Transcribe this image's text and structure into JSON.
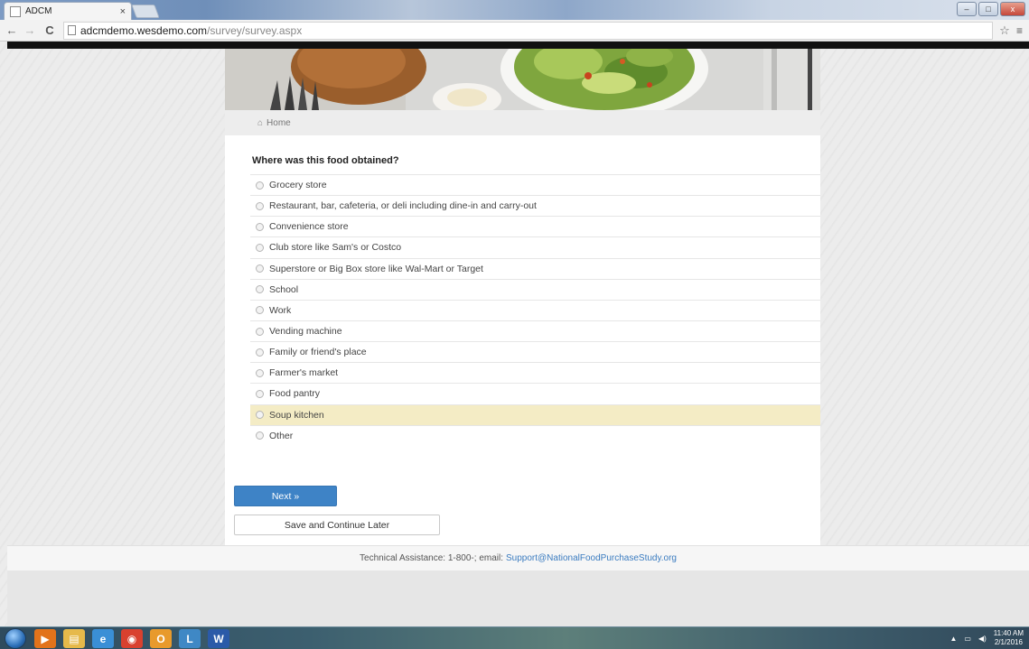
{
  "browser": {
    "tab_title": "ADCM",
    "tab_close": "×",
    "url_host": "adcmdemo.wesdemo.com",
    "url_path": "/survey/survey.aspx",
    "back": "←",
    "forward": "→",
    "reload": "C",
    "star": "☆",
    "menu": "≡",
    "win_min": "–",
    "win_max": "□",
    "win_close": "x"
  },
  "breadcrumb": {
    "home_icon": "⌂",
    "home_label": "Home"
  },
  "survey": {
    "question": "Where was this food obtained?",
    "options": [
      "Grocery store",
      "Restaurant, bar, cafeteria, or deli including dine-in and carry-out",
      "Convenience store",
      "Club store like Sam's or Costco",
      "Superstore or Big Box store like Wal-Mart or Target",
      "School",
      "Work",
      "Vending machine",
      "Family or friend's place",
      "Farmer's market",
      "Food pantry",
      "Soup kitchen",
      "Other"
    ],
    "highlighted_option": "Soup kitchen",
    "next_label": "Next »",
    "save_label": "Save and Continue Later"
  },
  "footer": {
    "text": "Technical Assistance: 1-800-; email:",
    "email": "Support@NationalFoodPurchaseStudy.org"
  },
  "taskbar": {
    "icons": [
      {
        "name": "media-player-icon",
        "glyph": "▶",
        "color": "#e2731b"
      },
      {
        "name": "file-explorer-icon",
        "glyph": "▤",
        "color": "#e6b94a"
      },
      {
        "name": "internet-explorer-icon",
        "glyph": "e",
        "color": "#3a8fd6"
      },
      {
        "name": "chrome-icon",
        "glyph": "◉",
        "color": "#d9412f"
      },
      {
        "name": "app-icon",
        "glyph": "O",
        "color": "#e89a2c"
      },
      {
        "name": "lync-icon",
        "glyph": "L",
        "color": "#3f88c5"
      },
      {
        "name": "word-icon",
        "glyph": "W",
        "color": "#2b5aa8"
      }
    ],
    "tray_up": "▲",
    "tray_network": "▭",
    "tray_volume": "◀)",
    "time": "11:40 AM",
    "date": "2/1/2016"
  },
  "colors": {
    "accent": "#3e83c6",
    "highlight": "#f4ecc5",
    "link": "#3b7cc0"
  }
}
